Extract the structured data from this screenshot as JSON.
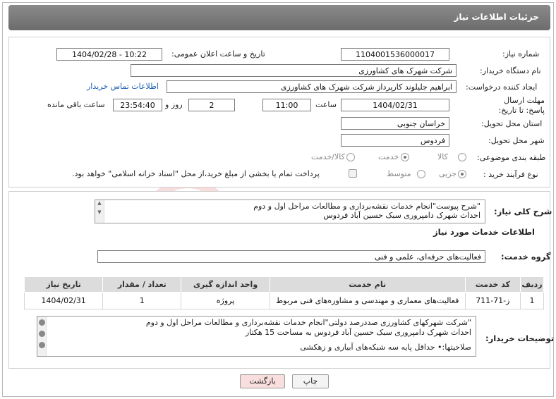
{
  "title": "جزئیات اطلاعات نیاز",
  "form": {
    "need_number_label": "شماره نیاز:",
    "need_number": "1104001536000017",
    "announce_label": "تاریخ و ساعت اعلان عمومی:",
    "announce_value": "1404/02/28 - 10:22",
    "buyer_org_label": "نام دستگاه خریدار:",
    "buyer_org": "شرکت شهرک های کشاورزی",
    "requester_label": "ایجاد کننده درخواست:",
    "requester": "ابراهیم جلیلوند کارپرداز شرکت شهرک های کشاورزی",
    "contact_link": "اطلاعات تماس خریدار",
    "deadline_label": "مهلت ارسال پاسخ: تا تاریخ:",
    "deadline_date": "1404/02/31",
    "time_label": "ساعت",
    "deadline_time": "11:00",
    "days_value": "2",
    "days_label": "روز و",
    "remaining_value": "23:54:40",
    "remaining_label": "ساعت باقی مانده",
    "province_label": "استان محل تحویل:",
    "province": "خراسان جنوبی",
    "city_label": "شهر محل تحویل:",
    "city": "فردوس",
    "category_label": "طبقه بندی موضوعی:",
    "category_options": [
      "کالا",
      "خدمت",
      "کالا/خدمت"
    ],
    "category_selected": "خدمت",
    "process_label": "نوع فرآیند خرید :",
    "process_options": [
      "جزیی",
      "متوسط"
    ],
    "process_selected": "جزیی",
    "payment_text": "پرداخت تمام یا بخشی از مبلغ خرید،از محل \"اسناد خزانه اسلامی\" خواهد بود."
  },
  "summary": {
    "label": "شرح کلی نیاز:",
    "line1": "\"شرح پیوست\"انجام خدمات نقشه‌برداری و مطالعات مراحل اول و دوم",
    "line2": "احداث شهرک دامپروری سبک حسین آباد فردوس"
  },
  "services": {
    "section_title": "اطلاعات خدمات مورد نیاز",
    "group_label": "گروه خدمت:",
    "group_value": "فعالیت‌های حرفه‌ای، علمی و فنی",
    "headers": [
      "ردیف",
      "کد خدمت",
      "نام خدمت",
      "واحد اندازه گیری",
      "تعداد / مقدار",
      "تاریخ نیاز"
    ],
    "rows": [
      [
        "1",
        "ز-71-711",
        "فعالیت‌های معماری و مهندسی و مشاوره‌های فنی مربوط",
        "پروژه",
        "1",
        "1404/02/31"
      ]
    ]
  },
  "buyer_notes": {
    "label": "توضیحات خریدار:",
    "line1": "\"شرکت شهرکهای کشاورزی صددرصد دولتی\"انجام خدمات نقشه‌برداری و مطالعات مراحل اول و دوم",
    "line2": "احداث شهرک دامپروری سبک حسین آباد فردوس به مساحت 15 هکتار",
    "line3": "صلاحیتها:•  حداقل پایه سه شبکه‌های آبیاری و زهکشی"
  },
  "buttons": {
    "print": "چاپ",
    "back": "بازگشت"
  },
  "watermark_text": "AriaTender.net",
  "colors": {
    "title_bar": "#7a7a7a",
    "link": "#1a5fb4",
    "back_button": "#f9dede",
    "table_header": "#dcdcdc"
  }
}
